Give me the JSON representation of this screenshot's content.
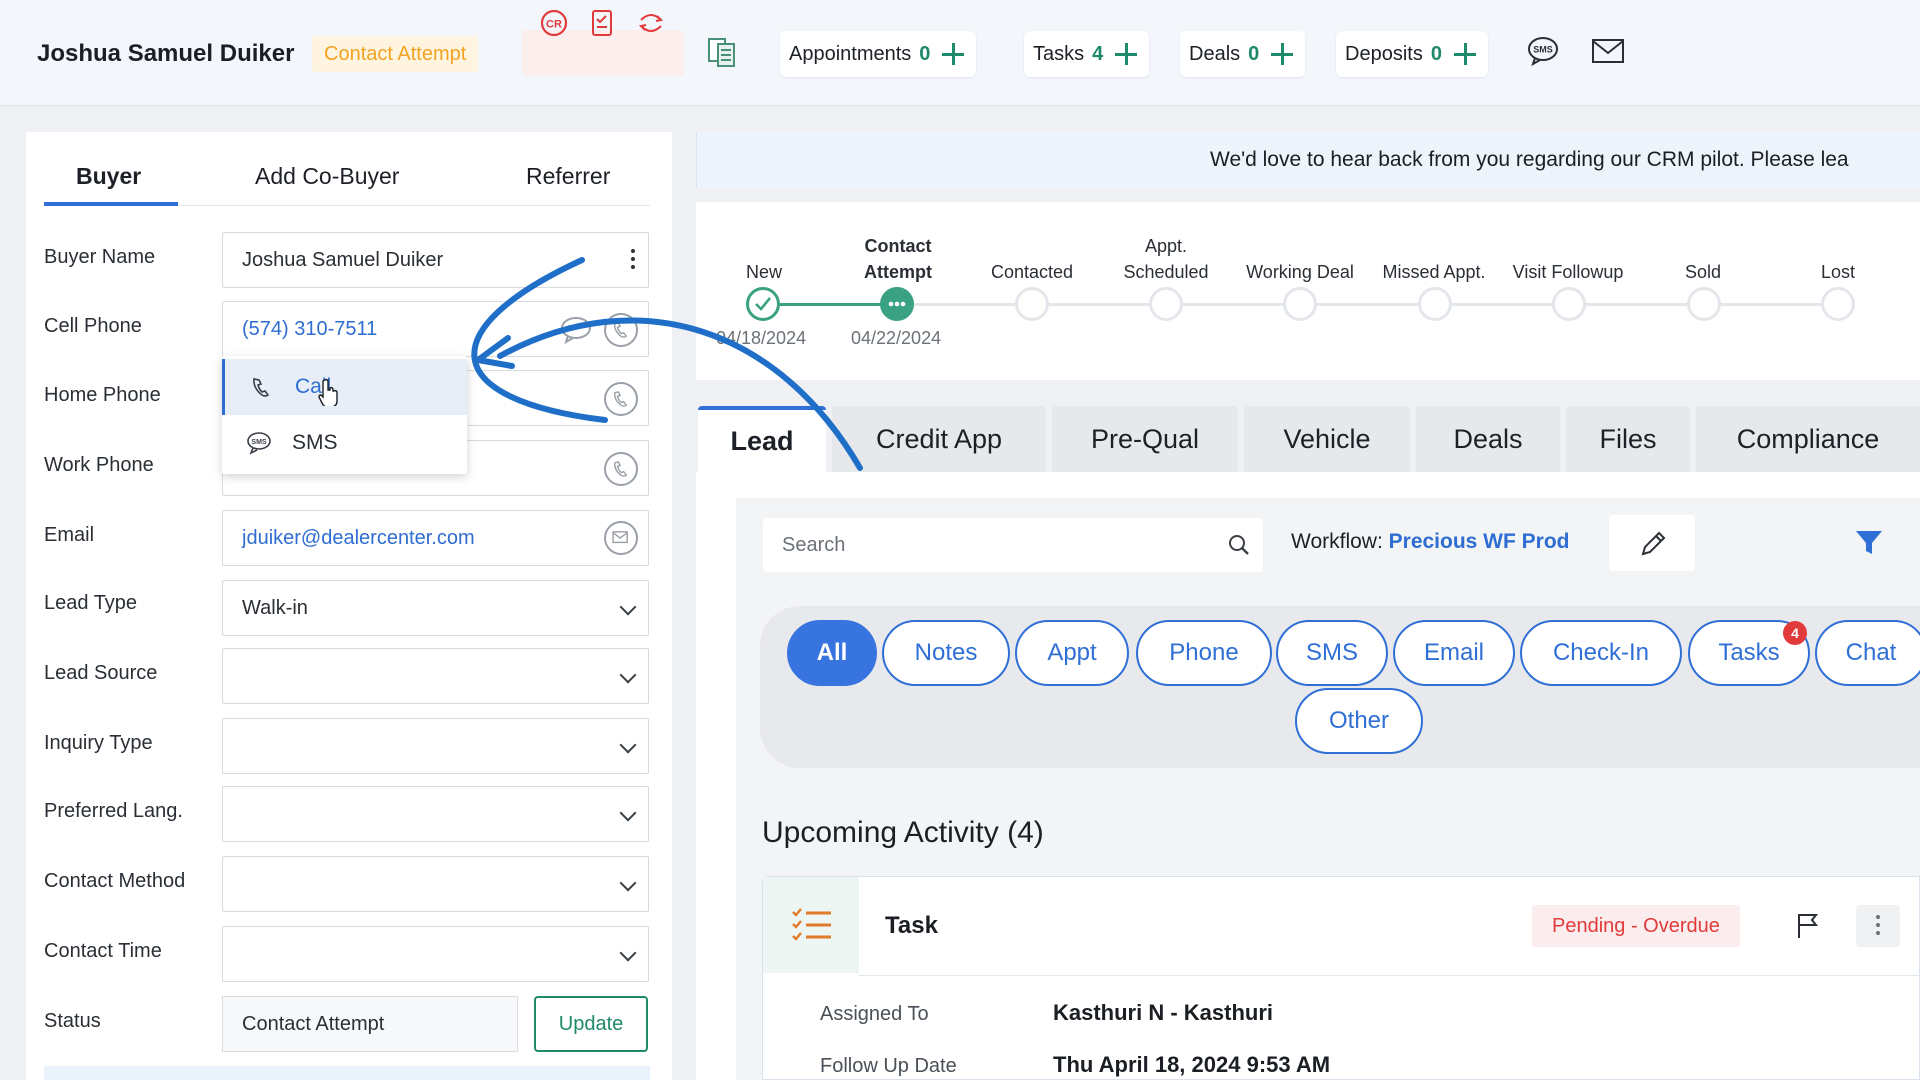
{
  "header": {
    "customer_name": "Joshua Samuel Duiker",
    "status": "Contact Attempt",
    "pills": [
      {
        "label": "Appointments",
        "count": "0"
      },
      {
        "label": "Tasks",
        "count": "4"
      },
      {
        "label": "Deals",
        "count": "0"
      },
      {
        "label": "Deposits",
        "count": "0"
      }
    ],
    "icons": [
      "cr-icon",
      "checklist-icon",
      "transfer-icon",
      "document-icon",
      "sms-icon",
      "mail-icon"
    ]
  },
  "left": {
    "tabs": [
      "Buyer",
      "Add Co-Buyer",
      "Referrer"
    ],
    "fields": {
      "buyer_name": {
        "label": "Buyer Name",
        "value": "Joshua Samuel Duiker"
      },
      "cell_phone": {
        "label": "Cell Phone",
        "value": "(574) 310-7511"
      },
      "home_phone": {
        "label": "Home Phone",
        "value": ""
      },
      "work_phone": {
        "label": "Work Phone",
        "value": ""
      },
      "email": {
        "label": "Email",
        "value": "jduiker@dealercenter.com"
      },
      "lead_type": {
        "label": "Lead Type",
        "value": "Walk-in"
      },
      "lead_source": {
        "label": "Lead Source",
        "value": ""
      },
      "inquiry_type": {
        "label": "Inquiry Type",
        "value": ""
      },
      "preferred_lang": {
        "label": "Preferred Lang.",
        "value": ""
      },
      "contact_method": {
        "label": "Contact Method",
        "value": ""
      },
      "contact_time": {
        "label": "Contact Time",
        "value": ""
      },
      "status": {
        "label": "Status",
        "value": "Contact Attempt"
      }
    },
    "update_label": "Update",
    "phone_menu": [
      {
        "label": "Call",
        "icon": "phone-icon"
      },
      {
        "label": "SMS",
        "icon": "sms-icon"
      }
    ]
  },
  "banner": "We'd love to hear back from you regarding our CRM pilot. Please lea",
  "stages": [
    {
      "label": "New",
      "date": "04/18/2024"
    },
    {
      "label_line1": "Contact",
      "label_line2": "Attempt",
      "date": "04/22/2024"
    },
    {
      "label": "Contacted"
    },
    {
      "label_line1": "Appt.",
      "label_line2": "Scheduled"
    },
    {
      "label": "Working Deal"
    },
    {
      "label": "Missed Appt."
    },
    {
      "label": "Visit Followup"
    },
    {
      "label": "Sold"
    },
    {
      "label": "Lost"
    }
  ],
  "tabs": [
    "Lead",
    "Credit App",
    "Pre-Qual",
    "Vehicle",
    "Deals",
    "Files",
    "Compliance"
  ],
  "search_placeholder": "Search",
  "workflow": {
    "label": "Workflow:",
    "value": "Precious WF Prod"
  },
  "filters": [
    "All",
    "Notes",
    "Appt",
    "Phone",
    "SMS",
    "Email",
    "Check-In",
    "Tasks",
    "Chat",
    "Other"
  ],
  "tasks_badge": "4",
  "upcoming_title": "Upcoming Activity (4)",
  "task": {
    "title": "Task",
    "status": "Pending - Overdue",
    "assigned_label": "Assigned To",
    "assigned_value": "Kasthuri N - Kasthuri",
    "followup_label": "Follow Up Date",
    "followup_value": "Thu April 18, 2024 9:53 AM"
  },
  "colors": {
    "accent": "#2f6fd6",
    "green": "#1f8a6b",
    "orange": "#f2a321",
    "red": "#e23b3b",
    "annotation": "#1f6fc8"
  }
}
